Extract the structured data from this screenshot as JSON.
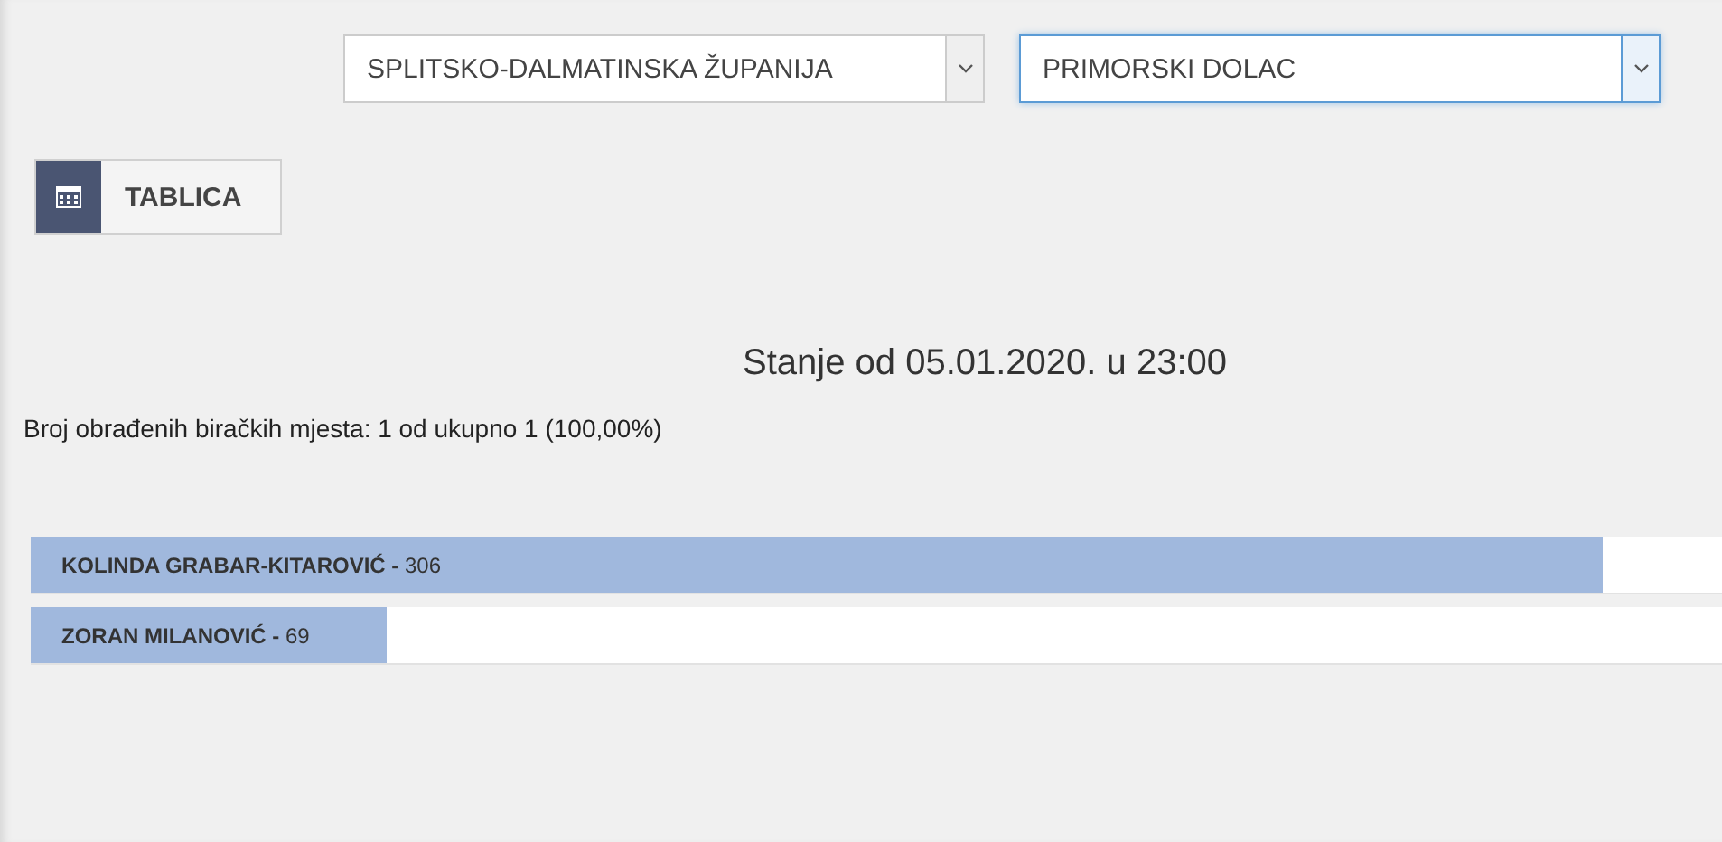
{
  "selects": [
    {
      "value": "SPLITSKO-DALMATINSKA ŽUPANIJA",
      "focused": false
    },
    {
      "value": "PRIMORSKI DOLAC",
      "focused": true
    }
  ],
  "view_button": {
    "label": "TABLICA"
  },
  "title": "Stanje od 05.01.2020. u 23:00",
  "summary": "Broj obrađenih biračkih mjesta: 1 od ukupno 1 (100,00%)",
  "candidates": [
    {
      "label": "**KOLINDA GRABAR-KITAROVIĆ -** 306",
      "level": 0.93
    },
    {
      "label": "**ZORAN MILANOVIĆ -** 69",
      "level": 0.21
    }
  ]
}
